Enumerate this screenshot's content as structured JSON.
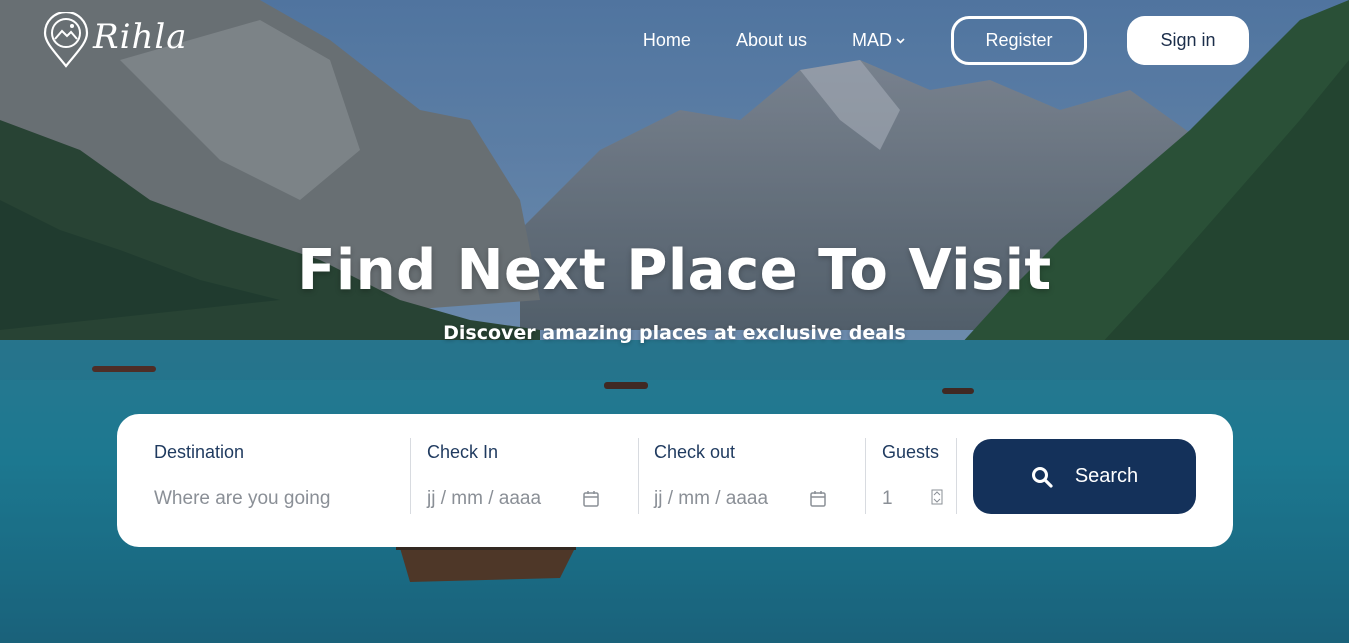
{
  "brand": {
    "name": "Rihla"
  },
  "nav": {
    "home": "Home",
    "about": "About us",
    "currency": "MAD",
    "register": "Register",
    "signin": "Sign in"
  },
  "hero": {
    "title": "Find Next Place To Visit",
    "subtitle": "Discover amazing places at exclusive deals"
  },
  "search": {
    "destination": {
      "label": "Destination",
      "placeholder": "Where are you going"
    },
    "check_in": {
      "label": "Check In",
      "value": "jj / mm / aaaa"
    },
    "check_out": {
      "label": "Check out",
      "value": "jj / mm / aaaa"
    },
    "guests": {
      "label": "Guests",
      "value": "1"
    },
    "button": "Search"
  },
  "colors": {
    "primary": "#14315a",
    "label": "#1f3a5f",
    "placeholder": "#8a8f96"
  }
}
